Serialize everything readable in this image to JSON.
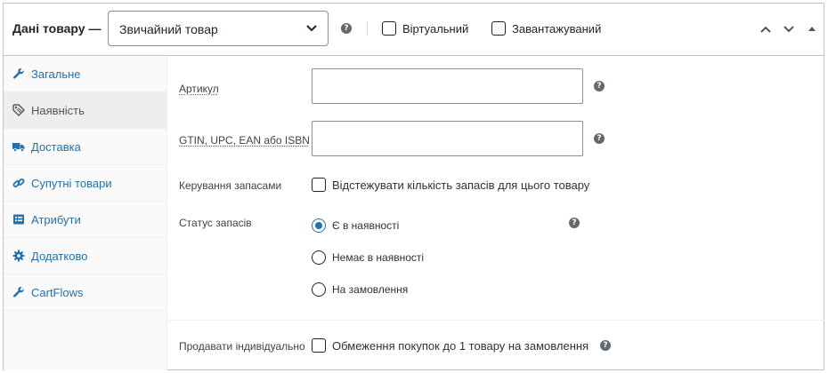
{
  "header": {
    "title": "Дані товару —",
    "product_type": "Звичайний товар",
    "virtual_label": "Віртуальний",
    "downloadable_label": "Завантажуваний"
  },
  "sidebar": {
    "items": [
      {
        "label": "Загальне",
        "icon": "wrench-icon"
      },
      {
        "label": "Наявність",
        "icon": "tag-icon",
        "active": true
      },
      {
        "label": "Доставка",
        "icon": "truck-icon"
      },
      {
        "label": "Супутні товари",
        "icon": "link-icon"
      },
      {
        "label": "Атрибути",
        "icon": "list-icon"
      },
      {
        "label": "Додатково",
        "icon": "gear-icon"
      },
      {
        "label": "CartFlows",
        "icon": "wrench-icon"
      }
    ]
  },
  "inventory": {
    "sku_label": "Артикул",
    "sku_value": "",
    "gtin_label": "GTIN, UPC, EAN або ISBN",
    "gtin_value": "",
    "manage_stock_label": "Керування запасами",
    "manage_stock_checkbox_label": "Відстежувати кількість запасів для цього товару",
    "stock_status_label": "Статус запасів",
    "stock_status_options": [
      {
        "label": "Є в наявності",
        "selected": true
      },
      {
        "label": "Немає в наявності",
        "selected": false
      },
      {
        "label": "На замовлення",
        "selected": false
      }
    ],
    "sold_individually_label": "Продавати індивідуально",
    "sold_individually_checkbox_label": "Обмеження покупок до 1 товару на замовлення"
  },
  "colors": {
    "accent": "#2271b1",
    "border": "#c3c4c7",
    "text": "#1d2327"
  }
}
